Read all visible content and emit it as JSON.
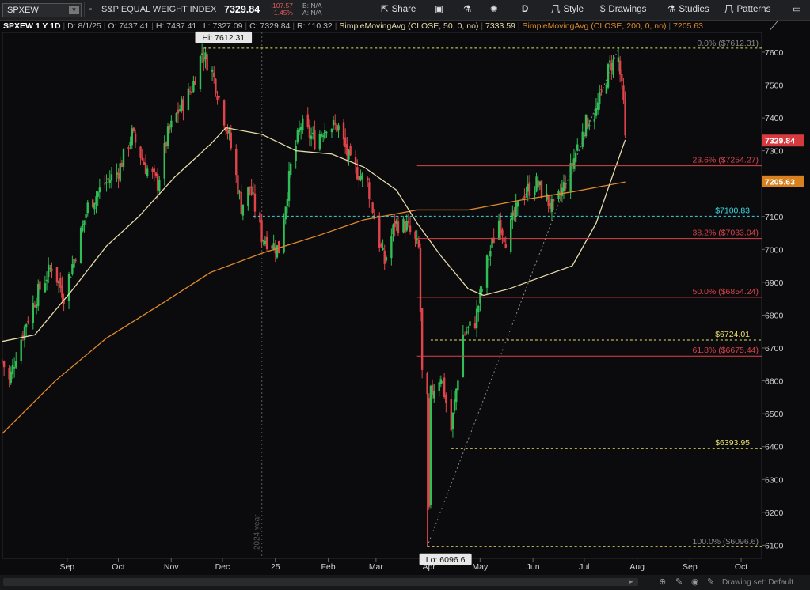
{
  "toolbar": {
    "symbol": "SPXEW",
    "description": "S&P EQUAL WEIGHT INDEX",
    "last": "7329.84",
    "net_change": "-107.57",
    "pct_change": "-1.45%",
    "bid": "B: N/A",
    "ask": "A: N/A",
    "share_label": "Share",
    "period_label": "D",
    "style_label": "Style",
    "drawings_label": "Drawings",
    "studies_label": "Studies",
    "patterns_label": "Patterns"
  },
  "info": {
    "title": "SPXEW 1 Y 1D",
    "date": "D: 8/1/25",
    "open": "O: 7437.41",
    "high": "H: 7437.41",
    "low": "L: 7327.09",
    "close": "C: 7329.84",
    "range": "R: 110.32",
    "sma50_label": "SimpleMovingAvg (CLOSE, 50, 0, no)",
    "sma50_value": "7333.59",
    "sma200_label": "SimpleMovingAvg (CLOSE, 200, 0, no)",
    "sma200_value": "7205.63"
  },
  "colors": {
    "up": "#2fbf56",
    "down": "#e0434a",
    "sma50": "#e6dcaa",
    "sma200": "#e08a2a",
    "fib": "#d9434a",
    "yellow_dash": "#e6e06a",
    "cyan": "#3ad6e0",
    "bg": "#0b0b0d"
  },
  "chart_data": {
    "type": "candlestick",
    "ylim": [
      6060,
      7660
    ],
    "y_ticks": [
      6100,
      6200,
      6300,
      6400,
      6500,
      6600,
      6700,
      6800,
      6900,
      7000,
      7100,
      7200,
      7300,
      7400,
      7500,
      7600
    ],
    "x_labels": [
      "Sep",
      "Oct",
      "Nov",
      "Dec",
      "25",
      "Feb",
      "Mar",
      "Apr",
      "May",
      "Jun",
      "Jul",
      "Aug",
      "Sep",
      "Oct"
    ],
    "x_label_dates": [
      "2024-09-01",
      "2024-10-01",
      "2024-11-01",
      "2024-12-01",
      "2025-01-01",
      "2025-02-01",
      "2025-03-01",
      "2025-04-01",
      "2025-05-01",
      "2025-06-01",
      "2025-07-01",
      "2025-08-01",
      "2025-09-01",
      "2025-10-01"
    ],
    "year_marker": "2024 year",
    "date_range": [
      "2024-08-01",
      "2025-10-20"
    ],
    "close_path": [
      [
        "2024-08-01",
        6660
      ],
      [
        "2024-08-05",
        6600
      ],
      [
        "2024-08-09",
        6680
      ],
      [
        "2024-08-15",
        6780
      ],
      [
        "2024-08-22",
        6870
      ],
      [
        "2024-08-30",
        6950
      ],
      [
        "2024-09-06",
        6860
      ],
      [
        "2024-09-13",
        6990
      ],
      [
        "2024-09-20",
        7130
      ],
      [
        "2024-09-30",
        7200
      ],
      [
        "2024-10-08",
        7240
      ],
      [
        "2024-10-16",
        7350
      ],
      [
        "2024-10-24",
        7250
      ],
      [
        "2024-10-31",
        7200
      ],
      [
        "2024-11-06",
        7350
      ],
      [
        "2024-11-12",
        7420
      ],
      [
        "2024-11-20",
        7490
      ],
      [
        "2024-11-26",
        7600
      ],
      [
        "2024-12-02",
        7540
      ],
      [
        "2024-12-06",
        7460
      ],
      [
        "2024-12-12",
        7340
      ],
      [
        "2024-12-19",
        7130
      ],
      [
        "2024-12-24",
        7190
      ],
      [
        "2024-12-31",
        7040
      ],
      [
        "2025-01-10",
        7000
      ],
      [
        "2025-01-17",
        7250
      ],
      [
        "2025-01-23",
        7380
      ],
      [
        "2025-01-31",
        7330
      ],
      [
        "2025-02-07",
        7380
      ],
      [
        "2025-02-14",
        7370
      ],
      [
        "2025-02-21",
        7260
      ],
      [
        "2025-03-03",
        7200
      ],
      [
        "2025-03-10",
        7020
      ],
      [
        "2025-03-13",
        6960
      ],
      [
        "2025-03-19",
        7080
      ],
      [
        "2025-03-26",
        7070
      ],
      [
        "2025-04-02",
        7000
      ],
      [
        "2025-04-04",
        6620
      ],
      [
        "2025-04-08",
        6200
      ],
      [
        "2025-04-09",
        6560
      ],
      [
        "2025-04-15",
        6620
      ],
      [
        "2025-04-21",
        6450
      ],
      [
        "2025-04-28",
        6740
      ],
      [
        "2025-05-05",
        6780
      ],
      [
        "2025-05-12",
        6960
      ],
      [
        "2025-05-19",
        7090
      ],
      [
        "2025-05-23",
        7030
      ],
      [
        "2025-06-02",
        7170
      ],
      [
        "2025-06-10",
        7200
      ],
      [
        "2025-06-20",
        7120
      ],
      [
        "2025-06-30",
        7240
      ],
      [
        "2025-07-07",
        7370
      ],
      [
        "2025-07-15",
        7420
      ],
      [
        "2025-07-23",
        7560
      ],
      [
        "2025-07-28",
        7580
      ],
      [
        "2025-07-31",
        7437
      ],
      [
        "2025-08-01",
        7330
      ]
    ],
    "sma50": [
      [
        "2024-08-01",
        6720
      ],
      [
        "2024-08-20",
        6740
      ],
      [
        "2024-09-10",
        6870
      ],
      [
        "2024-10-01",
        7010
      ],
      [
        "2024-10-20",
        7100
      ],
      [
        "2024-11-10",
        7220
      ],
      [
        "2024-12-01",
        7320
      ],
      [
        "2024-12-10",
        7370
      ],
      [
        "2024-12-31",
        7350
      ],
      [
        "2025-01-20",
        7300
      ],
      [
        "2025-02-10",
        7290
      ],
      [
        "2025-03-01",
        7250
      ],
      [
        "2025-03-20",
        7180
      ],
      [
        "2025-04-01",
        7080
      ],
      [
        "2025-04-15",
        6980
      ],
      [
        "2025-05-01",
        6880
      ],
      [
        "2025-05-10",
        6860
      ],
      [
        "2025-05-25",
        6880
      ],
      [
        "2025-06-15",
        6920
      ],
      [
        "2025-07-01",
        6950
      ],
      [
        "2025-07-15",
        7080
      ],
      [
        "2025-07-25",
        7230
      ],
      [
        "2025-08-01",
        7333
      ]
    ],
    "sma200": [
      [
        "2024-08-01",
        6440
      ],
      [
        "2024-09-01",
        6600
      ],
      [
        "2024-10-01",
        6730
      ],
      [
        "2024-11-01",
        6830
      ],
      [
        "2024-12-01",
        6930
      ],
      [
        "2025-01-01",
        6990
      ],
      [
        "2025-02-01",
        7040
      ],
      [
        "2025-03-01",
        7090
      ],
      [
        "2025-04-01",
        7120
      ],
      [
        "2025-05-01",
        7120
      ],
      [
        "2025-06-01",
        7150
      ],
      [
        "2025-07-01",
        7175
      ],
      [
        "2025-08-01",
        7205
      ]
    ],
    "annotations": {
      "high_label": "Hi: 7612.31",
      "high_value": 7612.31,
      "high_date": "2024-11-27",
      "low_label": "Lo: 6096.6",
      "low_value": 6096.6,
      "low_date": "2025-04-07",
      "current_price_label": "7329.84",
      "current_price": 7329.84,
      "sma200_price_label": "7205.63",
      "sma200_price": 7205.63,
      "fib_levels": [
        {
          "label": "0.0% ($7612.31)",
          "value": 7612.31,
          "kind": "fib0"
        },
        {
          "label": "23.6% ($7254.27)",
          "value": 7254.27,
          "kind": "fib"
        },
        {
          "label": "38.2% ($7033.04)",
          "value": 7033.04,
          "kind": "fib"
        },
        {
          "label": "50.0% ($6854.24)",
          "value": 6854.24,
          "kind": "fib"
        },
        {
          "label": "61.8% ($6675.44)",
          "value": 6675.44,
          "kind": "fib"
        },
        {
          "label": "100.0% ($6096.6)",
          "value": 6096.6,
          "kind": "fib0"
        }
      ],
      "fib_start_date": "2025-04-01",
      "fib_end_date": "2025-08-01",
      "cyan_level": {
        "label": "$7100.83",
        "value": 7100.83,
        "from": "2024-12-26"
      },
      "yellow_levels": [
        {
          "label": "$6724.01",
          "value": 6724.01,
          "from": "2025-04-09"
        },
        {
          "label": "$6393.95",
          "value": 6393.95,
          "from": "2025-04-21"
        }
      ],
      "trend_from": [
        "2025-04-07",
        6096.6
      ],
      "trend_to": [
        "2025-07-28",
        7612.31
      ]
    }
  },
  "footer": {
    "drawing_set": "Drawing set: Default"
  }
}
